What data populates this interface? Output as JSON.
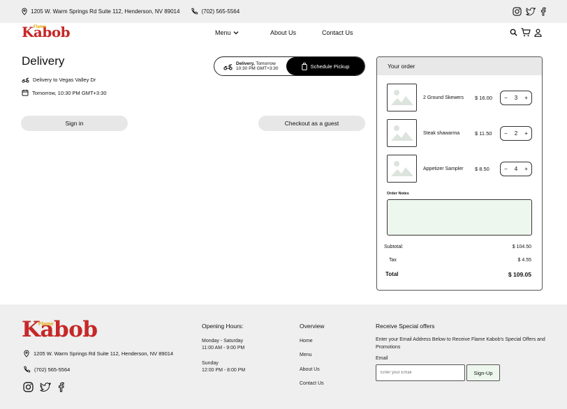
{
  "topbar": {
    "address": "1205 W. Warm Springs Rd Suite 112, Henderson, NV 89014",
    "phone": "(702) 565-5564"
  },
  "brand": {
    "logo_text": "Kabob",
    "logo_small": "Flame"
  },
  "nav": {
    "menu": "Menu",
    "about": "About Us",
    "contact": "Contact Us"
  },
  "main": {
    "title": "Delivery",
    "delivery_to": "Delivery to Vegas Valley Dr",
    "delivery_time": "Tomorrow, 10:30 PM GMT+3:30",
    "toggle": {
      "delivery_label": "Delivery,",
      "delivery_day": " Tomorrow",
      "delivery_time": "10:30 PM GMT+3:30",
      "pickup_label": "Schedule Pickup"
    },
    "sign_in": "Sign in",
    "guest": "Checkout as a guest"
  },
  "order": {
    "title": "Your order",
    "items": [
      {
        "name": "2 Ground Skewers",
        "price": "$ 16.00",
        "qty": "3"
      },
      {
        "name": "Steak shawarma",
        "price": "$ 11.50",
        "qty": "2"
      },
      {
        "name": "Appetizer Sampler",
        "price": "$ 8.50",
        "qty": "4"
      }
    ],
    "minus": "−",
    "plus": "+",
    "notes_label": "Order Notes",
    "subtotal_label": "Subtotal:",
    "subtotal": "$ 104.50",
    "tax_label": "Tax",
    "tax": "$ 4.55",
    "total_label": "Total",
    "total": "$ 109.05"
  },
  "footer": {
    "address": "1205 W. Warm Springs Rd Suite 112, Henderson, NV 89014",
    "phone": "(702) 565-5564",
    "hours_title": "Opening Hours:",
    "hours": [
      {
        "days": "Monday - Saturday",
        "time": "11:00 AM - 9:00 PM"
      },
      {
        "days": "Sunday",
        "time": "12:00 PM - 8:00 PM"
      }
    ],
    "overview_title": "Overview",
    "links": [
      "Home",
      "Menu",
      "About Us",
      "Contact Us"
    ],
    "offers_title": "Receive Special offers",
    "offers_text": "Enter your Email Address Below to Receive Flame Kabob's Special Offers and Promotions",
    "email_label": "Email",
    "email_placeholder": "Enter your Email",
    "signup": "Sign-Up"
  },
  "icons": [
    "location-icon",
    "phone-icon",
    "instagram-icon",
    "twitter-icon",
    "facebook-icon",
    "chevron-down-icon",
    "search-icon",
    "cart-icon",
    "user-icon",
    "scooter-icon",
    "calendar-icon",
    "bag-icon",
    "image-placeholder-icon"
  ],
  "colors": {
    "brand_red": "#c62828",
    "brand_yellow": "#e6a500",
    "notes_bg": "#eef7ee"
  }
}
